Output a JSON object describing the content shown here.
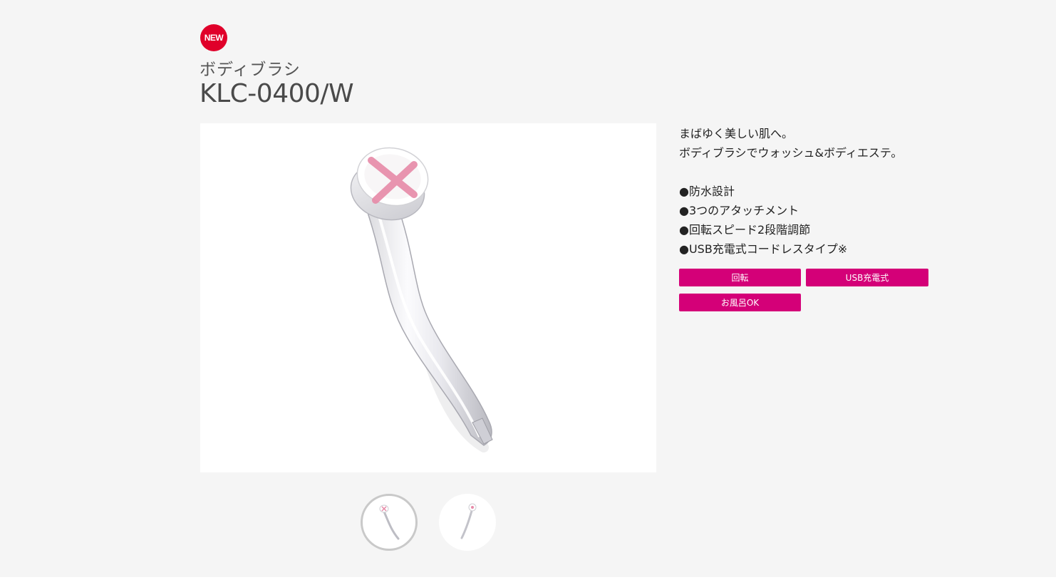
{
  "badge": {
    "label": "NEW",
    "color": "#e0002a"
  },
  "product": {
    "category": "ボディブラシ",
    "model": "KLC-0400/W"
  },
  "description": {
    "lines": [
      "まばゆく美しい肌へ。",
      "ボディブラシでウォッシュ&ボディエステ。"
    ],
    "features": [
      "●防水設計",
      "●3つのアタッチメント",
      "●回転スピード2段階調節",
      "●USB充電式コードレスタイプ※"
    ]
  },
  "tags": {
    "color": "#d40078",
    "items": [
      "回転",
      "USB充電式",
      "お風呂OK"
    ]
  },
  "gallery": {
    "thumbnails": [
      {
        "state": "selected"
      },
      {
        "state": "unselected"
      }
    ]
  }
}
